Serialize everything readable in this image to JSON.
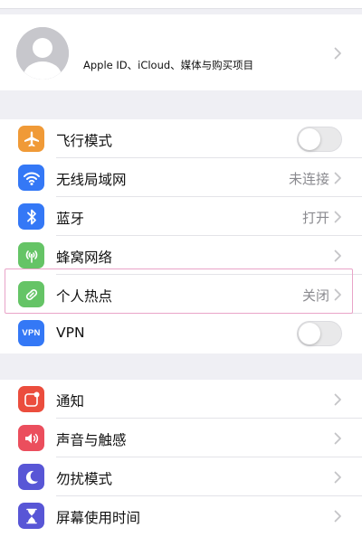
{
  "profile": {
    "label": "Apple ID、iCloud、媒体与购买项目"
  },
  "group_network": [
    {
      "label": "飞行模式",
      "icon": "airplane-icon",
      "color": "#f09a37",
      "control": "toggle",
      "on": false
    },
    {
      "label": "无线局域网",
      "icon": "wifi-icon",
      "color": "#3478f6",
      "value": "未连接"
    },
    {
      "label": "蓝牙",
      "icon": "bluetooth-icon",
      "color": "#3478f6",
      "value": "打开"
    },
    {
      "label": "蜂窝网络",
      "icon": "cellular-icon",
      "color": "#65c466",
      "value": ""
    },
    {
      "label": "个人热点",
      "icon": "hotspot-icon",
      "color": "#65c466",
      "value": "关闭",
      "highlighted": true
    },
    {
      "label": "VPN",
      "icon": "vpn-icon",
      "icon_text": "VPN",
      "color": "#3478f6",
      "control": "toggle",
      "on": false
    }
  ],
  "group_system": [
    {
      "label": "通知",
      "icon": "notifications-icon",
      "color": "#eb4d3d"
    },
    {
      "label": "声音与触感",
      "icon": "sound-icon",
      "color": "#eb4e5d"
    },
    {
      "label": "勿扰模式",
      "icon": "moon-icon",
      "color": "#5856d6"
    },
    {
      "label": "屏幕使用时间",
      "icon": "hourglass-icon",
      "color": "#5856d6"
    }
  ],
  "colors": {
    "background": "#efeff4",
    "separator": "#e3e3e8",
    "secondary_text": "#8a8a8f",
    "chevron": "#c4c4c7",
    "highlight_border": "#e9a4c8"
  }
}
